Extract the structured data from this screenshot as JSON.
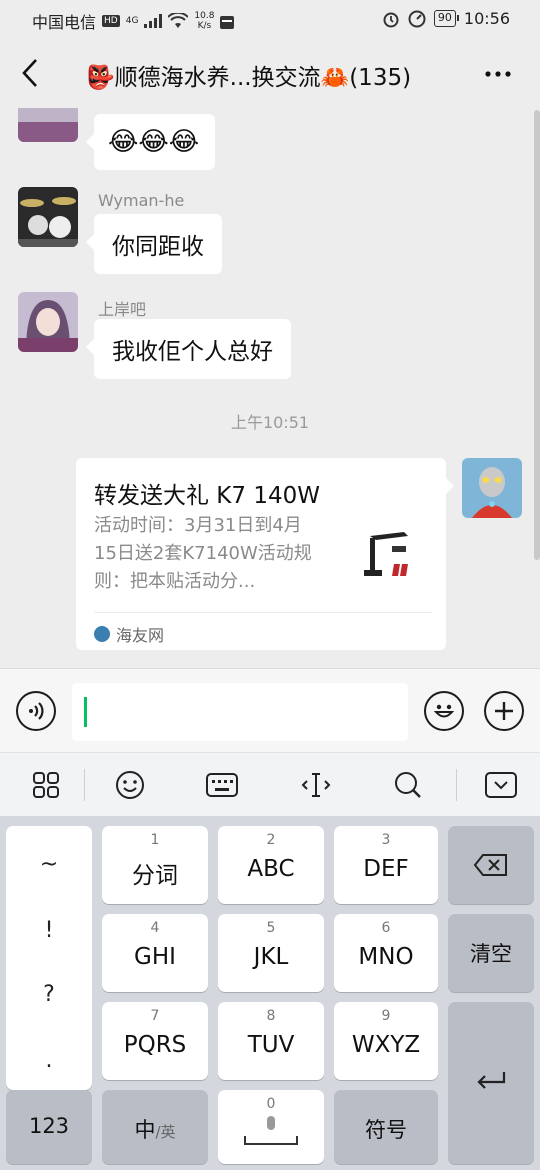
{
  "status_bar": {
    "carrier": "中国电信",
    "hd": "HD",
    "net": "4G",
    "speed_value": "10.8",
    "speed_unit": "K/s",
    "battery": "90",
    "time": "10:56"
  },
  "header": {
    "title": "👺顺德海水养...换交流🦀(135)",
    "more": "···"
  },
  "messages": [
    {
      "type": "emoji",
      "content": "😂😂😂"
    },
    {
      "type": "text",
      "nick": "Wyman-he",
      "content": "你同距收"
    },
    {
      "type": "text",
      "nick": "上岸吧",
      "content": "我收佢个人总好"
    }
  ],
  "time_divider": "上午10:51",
  "card": {
    "title": "转发送大礼 K7 140W",
    "desc": "活动时间：3月31日到4月15日送2套K7140W活动规则：把本贴活动分...",
    "source": "海友网"
  },
  "keyboard": {
    "punct": [
      "~",
      "!",
      "?",
      "."
    ],
    "rows": [
      [
        {
          "num": "1",
          "label": "分词"
        },
        {
          "num": "2",
          "label": "ABC"
        },
        {
          "num": "3",
          "label": "DEF"
        }
      ],
      [
        {
          "num": "4",
          "label": "GHI"
        },
        {
          "num": "5",
          "label": "JKL"
        },
        {
          "num": "6",
          "label": "MNO"
        }
      ],
      [
        {
          "num": "7",
          "label": "PQRS"
        },
        {
          "num": "8",
          "label": "TUV"
        },
        {
          "num": "9",
          "label": "WXYZ"
        }
      ]
    ],
    "clear": "清空",
    "mode_123": "123",
    "lang_main": "中",
    "lang_alt": "/英",
    "space_num": "0",
    "symbols": "符号"
  },
  "colors": {
    "accent": "#07c160",
    "background": "#ededed"
  }
}
